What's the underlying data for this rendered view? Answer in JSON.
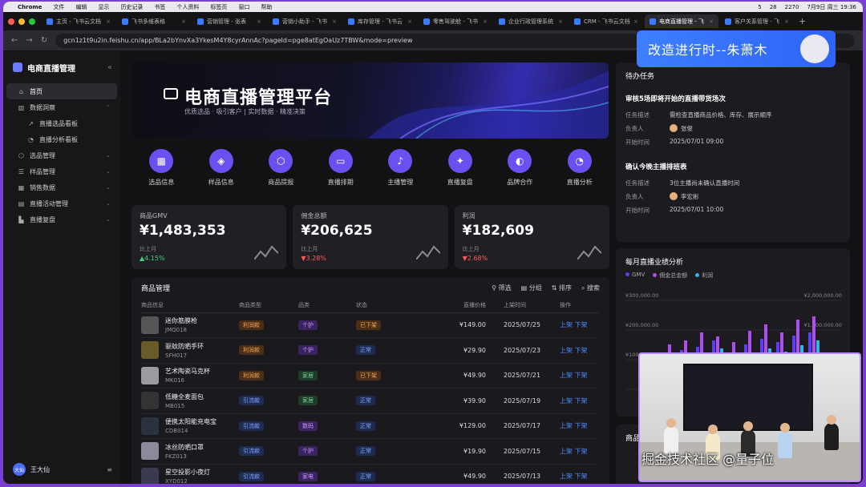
{
  "menubar": {
    "app": "Chrome",
    "items": [
      "文件",
      "编辑",
      "显示",
      "历史记录",
      "书签",
      "个人资料",
      "标签页",
      "窗口",
      "帮助"
    ],
    "status": [
      "5",
      "28",
      "2270"
    ],
    "clock": "7月9日 周三 19:36"
  },
  "tabs": [
    {
      "label": "主页 - 飞书云文档",
      "active": false
    },
    {
      "label": "飞书多维表格",
      "active": false
    },
    {
      "label": "营销管理 - 张表",
      "active": false
    },
    {
      "label": "营销小助手 - 飞书",
      "active": false
    },
    {
      "label": "库存管理 - 飞书云",
      "active": false
    },
    {
      "label": "零售驾驶舱 - 飞书",
      "active": false
    },
    {
      "label": "企业行政管理系统",
      "active": false
    },
    {
      "label": "CRM - 飞书云文档",
      "active": false
    },
    {
      "label": "电商直播管理 - 飞",
      "active": true
    },
    {
      "label": "客户关系管理 - 飞",
      "active": false
    }
  ],
  "address": {
    "url": "gcn1z1t9u2in.feishu.cn/app/BLa2bYnvXa3YkesM4Y8cyrAnnAc?pageId=pge8atEgOaUz7TBW&mode=preview"
  },
  "sidebar": {
    "title": "电商直播管理",
    "items": [
      {
        "label": "首页",
        "active": true,
        "sub": false,
        "chev": ""
      },
      {
        "label": "数据洞察",
        "active": false,
        "sub": false,
        "chev": "⌃"
      },
      {
        "label": "直播选品看板",
        "active": false,
        "sub": true,
        "chev": ""
      },
      {
        "label": "直播分析看板",
        "active": false,
        "sub": true,
        "chev": ""
      },
      {
        "label": "选品管理",
        "active": false,
        "sub": false,
        "chev": "⌄"
      },
      {
        "label": "样品管理",
        "active": false,
        "sub": false,
        "chev": "⌄"
      },
      {
        "label": "销售数据",
        "active": false,
        "sub": false,
        "chev": "⌄"
      },
      {
        "label": "直播活动管理",
        "active": false,
        "sub": false,
        "chev": "⌄"
      },
      {
        "label": "直播复盘",
        "active": false,
        "sub": false,
        "chev": "⌄"
      }
    ],
    "user": {
      "avatar_text": "大仙",
      "name": "王大仙"
    }
  },
  "banner": {
    "title": "电商直播管理平台",
    "subtitle": "优质选品 · 吸引客户 | 实时数据 · 精准决策"
  },
  "quick_icons": [
    {
      "label": "选品信息",
      "glyph": "▦"
    },
    {
      "label": "样品信息",
      "glyph": "◈"
    },
    {
      "label": "商品提报",
      "glyph": "⬡"
    },
    {
      "label": "直播排期",
      "glyph": "▭"
    },
    {
      "label": "主播管理",
      "glyph": "♪"
    },
    {
      "label": "直播复盘",
      "glyph": "✦"
    },
    {
      "label": "品牌合作",
      "glyph": "◐"
    },
    {
      "label": "直播分析",
      "glyph": "◔"
    }
  ],
  "kpis": [
    {
      "title": "商品GMV",
      "value": "¥1,483,353",
      "cmp": "比上月",
      "change": "▲4.15%",
      "color": "#3fd07f"
    },
    {
      "title": "佣金总额",
      "value": "¥206,625",
      "cmp": "比上月",
      "change": "▼3.28%",
      "color": "#ff5a5a"
    },
    {
      "title": "利润",
      "value": "¥182,609",
      "cmp": "比上月",
      "change": "▼2.68%",
      "color": "#ff5a5a"
    }
  ],
  "products": {
    "title": "商品管理",
    "tools": [
      "筛选",
      "分组",
      "排序",
      "搜索"
    ],
    "columns": [
      "商品信息",
      "商品类型",
      "品类",
      "状态",
      "直播价格",
      "上架时间",
      "操作"
    ],
    "rows": [
      {
        "name": "迷你筋膜枪",
        "code": "JMQ018",
        "type": "利润款",
        "cat": "个护",
        "status": "已下架",
        "price": "¥149.00",
        "date": "2025/07/25",
        "op1": "上架",
        "op2": "下架"
      },
      {
        "name": "驱蚊防晒手环",
        "code": "SFH017",
        "type": "利润款",
        "cat": "个护",
        "status": "正常",
        "price": "¥29.90",
        "date": "2025/07/23",
        "op1": "上架",
        "op2": "下架"
      },
      {
        "name": "艺术陶瓷马克杯",
        "code": "MK016",
        "type": "利润款",
        "cat": "家居",
        "status": "已下架",
        "price": "¥49.90",
        "date": "2025/07/21",
        "op1": "上架",
        "op2": "下架"
      },
      {
        "name": "低糖全麦面包",
        "code": "MB015",
        "type": "引流款",
        "cat": "家居",
        "status": "正常",
        "price": "¥39.90",
        "date": "2025/07/19",
        "op1": "上架",
        "op2": "下架"
      },
      {
        "name": "便携太阳能充电宝",
        "code": "CDB014",
        "type": "引流款",
        "cat": "数码",
        "status": "正常",
        "price": "¥129.00",
        "date": "2025/07/17",
        "op1": "上架",
        "op2": "下架"
      },
      {
        "name": "冰丝防晒口罩",
        "code": "FKZ013",
        "type": "引流款",
        "cat": "个护",
        "status": "正常",
        "price": "¥19.90",
        "date": "2025/07/15",
        "op1": "上架",
        "op2": "下架"
      },
      {
        "name": "星空投影小夜灯",
        "code": "XYD012",
        "type": "引流款",
        "cat": "家电",
        "status": "正常",
        "price": "¥49.90",
        "date": "2025/07/13",
        "op1": "上架",
        "op2": "下架"
      }
    ]
  },
  "todo": {
    "title": "待办任务",
    "items": [
      {
        "title": "审核5场即将开始的直播带货场次",
        "desc_l": "任务描述",
        "desc": "需检查直播商品价格、库存、展示顺序",
        "owner_l": "负责人",
        "owner": "张俊",
        "start_l": "开始时间",
        "start": "2025/07/01   09:00"
      },
      {
        "title": "确认今晚主播排班表",
        "desc_l": "任务描述",
        "desc": "3位主播尚未确认直播时间",
        "owner_l": "负责人",
        "owner": "李宏彬",
        "start_l": "开始时间",
        "start": "2025/07/01   10:00"
      }
    ]
  },
  "chart_data": {
    "type": "bar",
    "title": "每月直播业绩分析",
    "series": [
      {
        "name": "GMV"
      },
      {
        "name": "佣金总金额"
      },
      {
        "name": "利润"
      }
    ],
    "left_ticks": [
      "¥300,000.00",
      "¥200,000.00",
      "¥100,000.00"
    ],
    "right_ticks": [
      "¥2,000,000.00",
      "¥1,500,000.00",
      "¥1,000,000.00",
      "¥500,000.00"
    ],
    "colors": [
      "#5b3df0",
      "#b04cf0",
      "#2fb7e6"
    ]
  },
  "pm_card": {
    "title": "商品"
  },
  "overlay": {
    "text": "改造进行时--朱萧木"
  },
  "watermark": {
    "text": "掘金技术社区 @量子位"
  }
}
